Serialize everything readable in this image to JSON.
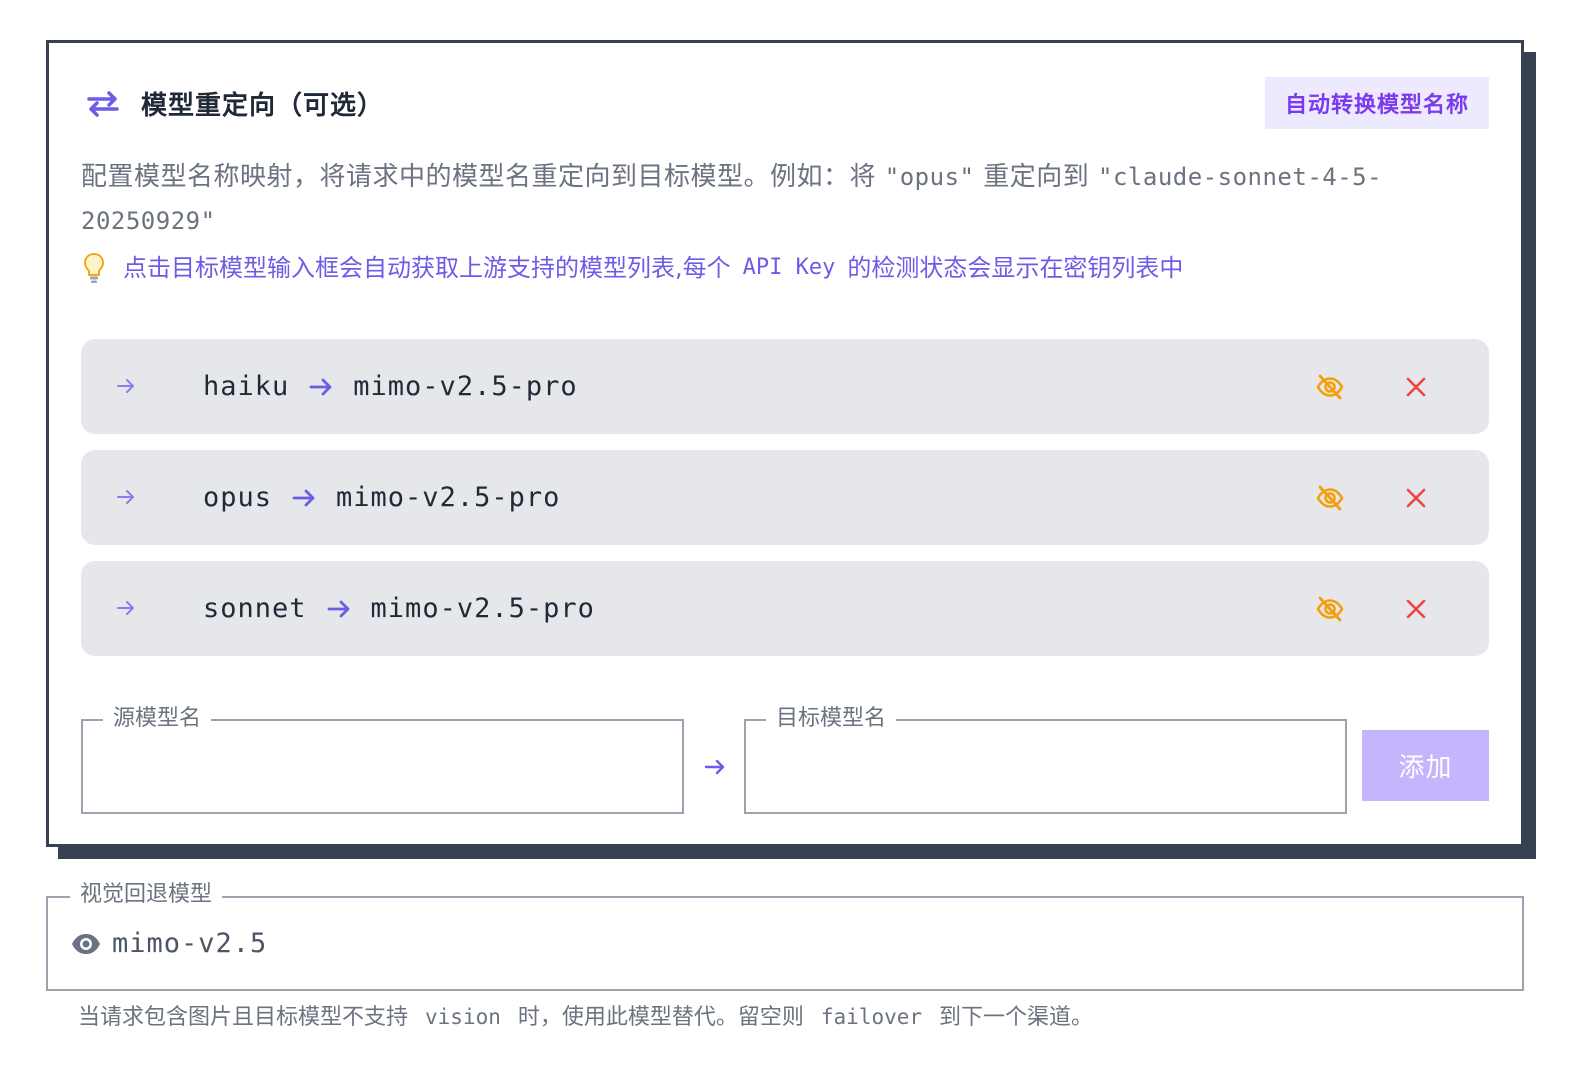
{
  "redirect": {
    "title": "模型重定向（可选）",
    "auto_button": "自动转换模型名称",
    "description": {
      "part1": "配置模型名称映射，将请求中的模型名重定向到目标模型。例如：将",
      "example_source": "\"opus\"",
      "part2": "重定向到",
      "example_target": "\"claude-sonnet-4-5-20250929\""
    },
    "tip": {
      "part1": "点击目标模型输入框会自动获取上游支持的模型列表,每个",
      "code": "API Key",
      "part2": "的检测状态会显示在密钥列表中"
    },
    "mappings": [
      {
        "source": "haiku",
        "target": "mimo-v2.5-pro"
      },
      {
        "source": "opus",
        "target": "mimo-v2.5-pro"
      },
      {
        "source": "sonnet",
        "target": "mimo-v2.5-pro"
      }
    ],
    "source_field": {
      "label": "源模型名",
      "value": ""
    },
    "target_field": {
      "label": "目标模型名",
      "value": ""
    },
    "add_button": "添加"
  },
  "vision": {
    "label": "视觉回退模型",
    "value": "mimo-v2.5",
    "help": {
      "part1": "当请求包含图片且目标模型不支持",
      "code1": "vision",
      "part2": "时，使用此模型替代。留空则",
      "code2": "failover",
      "part3": "到下一个渠道。"
    }
  },
  "colors": {
    "accent": "#6d5ce7",
    "border_dark": "#374151",
    "eye_off": "#f59e0b",
    "delete": "#ef4444",
    "add_button": "#c4b5fd"
  }
}
